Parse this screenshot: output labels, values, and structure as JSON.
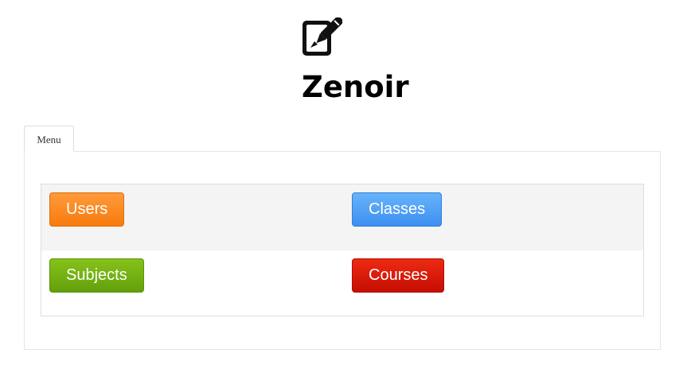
{
  "header": {
    "icon": "edit-pencil-icon",
    "title": "Zenoir"
  },
  "tabs": [
    {
      "label": "Menu"
    }
  ],
  "menu": {
    "buttons": {
      "users": {
        "label": "Users",
        "color": "#f7840f"
      },
      "classes": {
        "label": "Classes",
        "color": "#4a9cf5"
      },
      "subjects": {
        "label": "Subjects",
        "color": "#72b012"
      },
      "courses": {
        "label": "Courses",
        "color": "#d91a08"
      }
    }
  }
}
